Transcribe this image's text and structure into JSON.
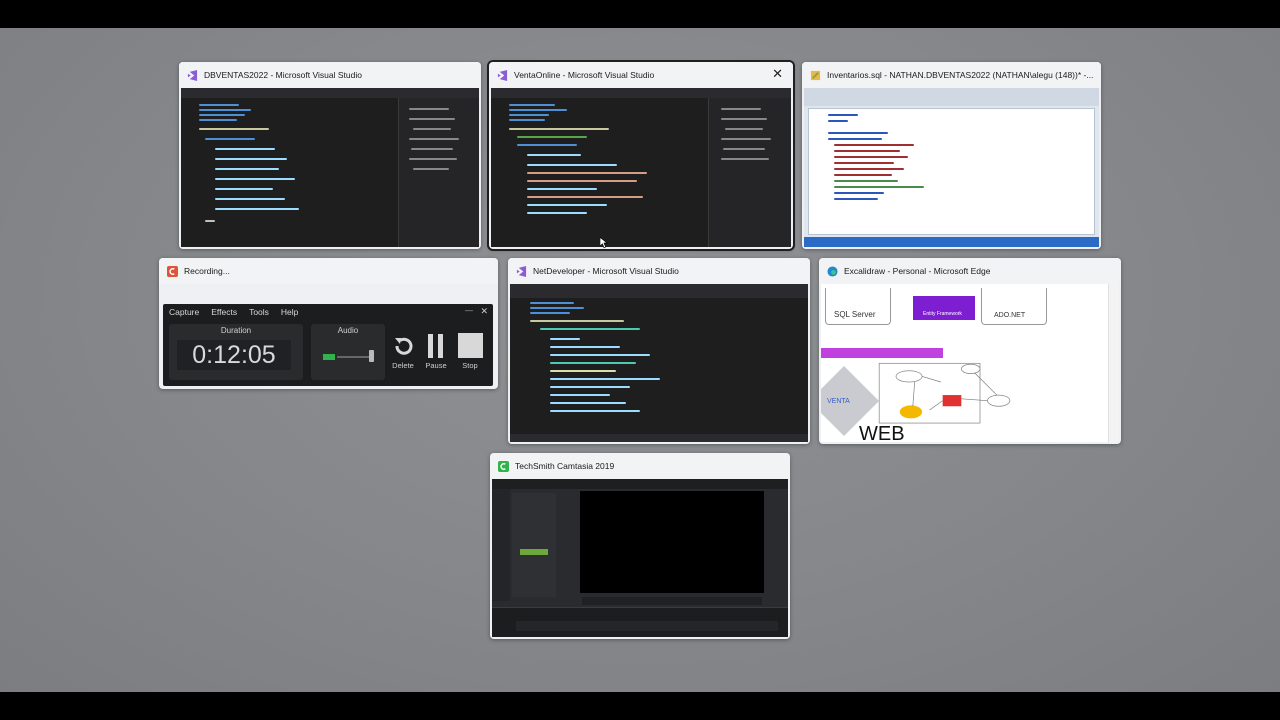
{
  "windows": {
    "dbventas": {
      "title": "DBVENTAS2022 - Microsoft Visual Studio"
    },
    "ventaonline": {
      "title": "VentaOnline - Microsoft Visual Studio",
      "close_label": "✕"
    },
    "inventarios": {
      "title": "Inventarios.sql - NATHAN.DBVENTAS2022 (NATHAN\\alegu (148))* -..."
    },
    "recording": {
      "title": "Recording...",
      "menu": [
        "Capture",
        "Effects",
        "Tools",
        "Help"
      ],
      "duration_label": "Duration",
      "duration": "0:12:05",
      "audio_label": "Audio",
      "delete_label": "Delete",
      "pause_label": "Pause",
      "stop_label": "Stop",
      "min_label": "—",
      "close_label": "✕"
    },
    "netdeveloper": {
      "title": "NetDeveloper - Microsoft Visual Studio"
    },
    "excalidraw": {
      "title": "Excalidraw - Personal - Microsoft Edge",
      "labels": {
        "sql": "SQL Server",
        "ef": "Entity Framework",
        "ado": "ADO.NET",
        "venta": "VENTA",
        "web": "WEB"
      }
    },
    "camtasia": {
      "title": "TechSmith Camtasia 2019"
    }
  },
  "colors": {
    "vs_purple": "#8a5cd6",
    "camtasia_green": "#2fb34a",
    "recording_red": "#e0533a",
    "excalidraw_purple": "#7d1fd1"
  }
}
